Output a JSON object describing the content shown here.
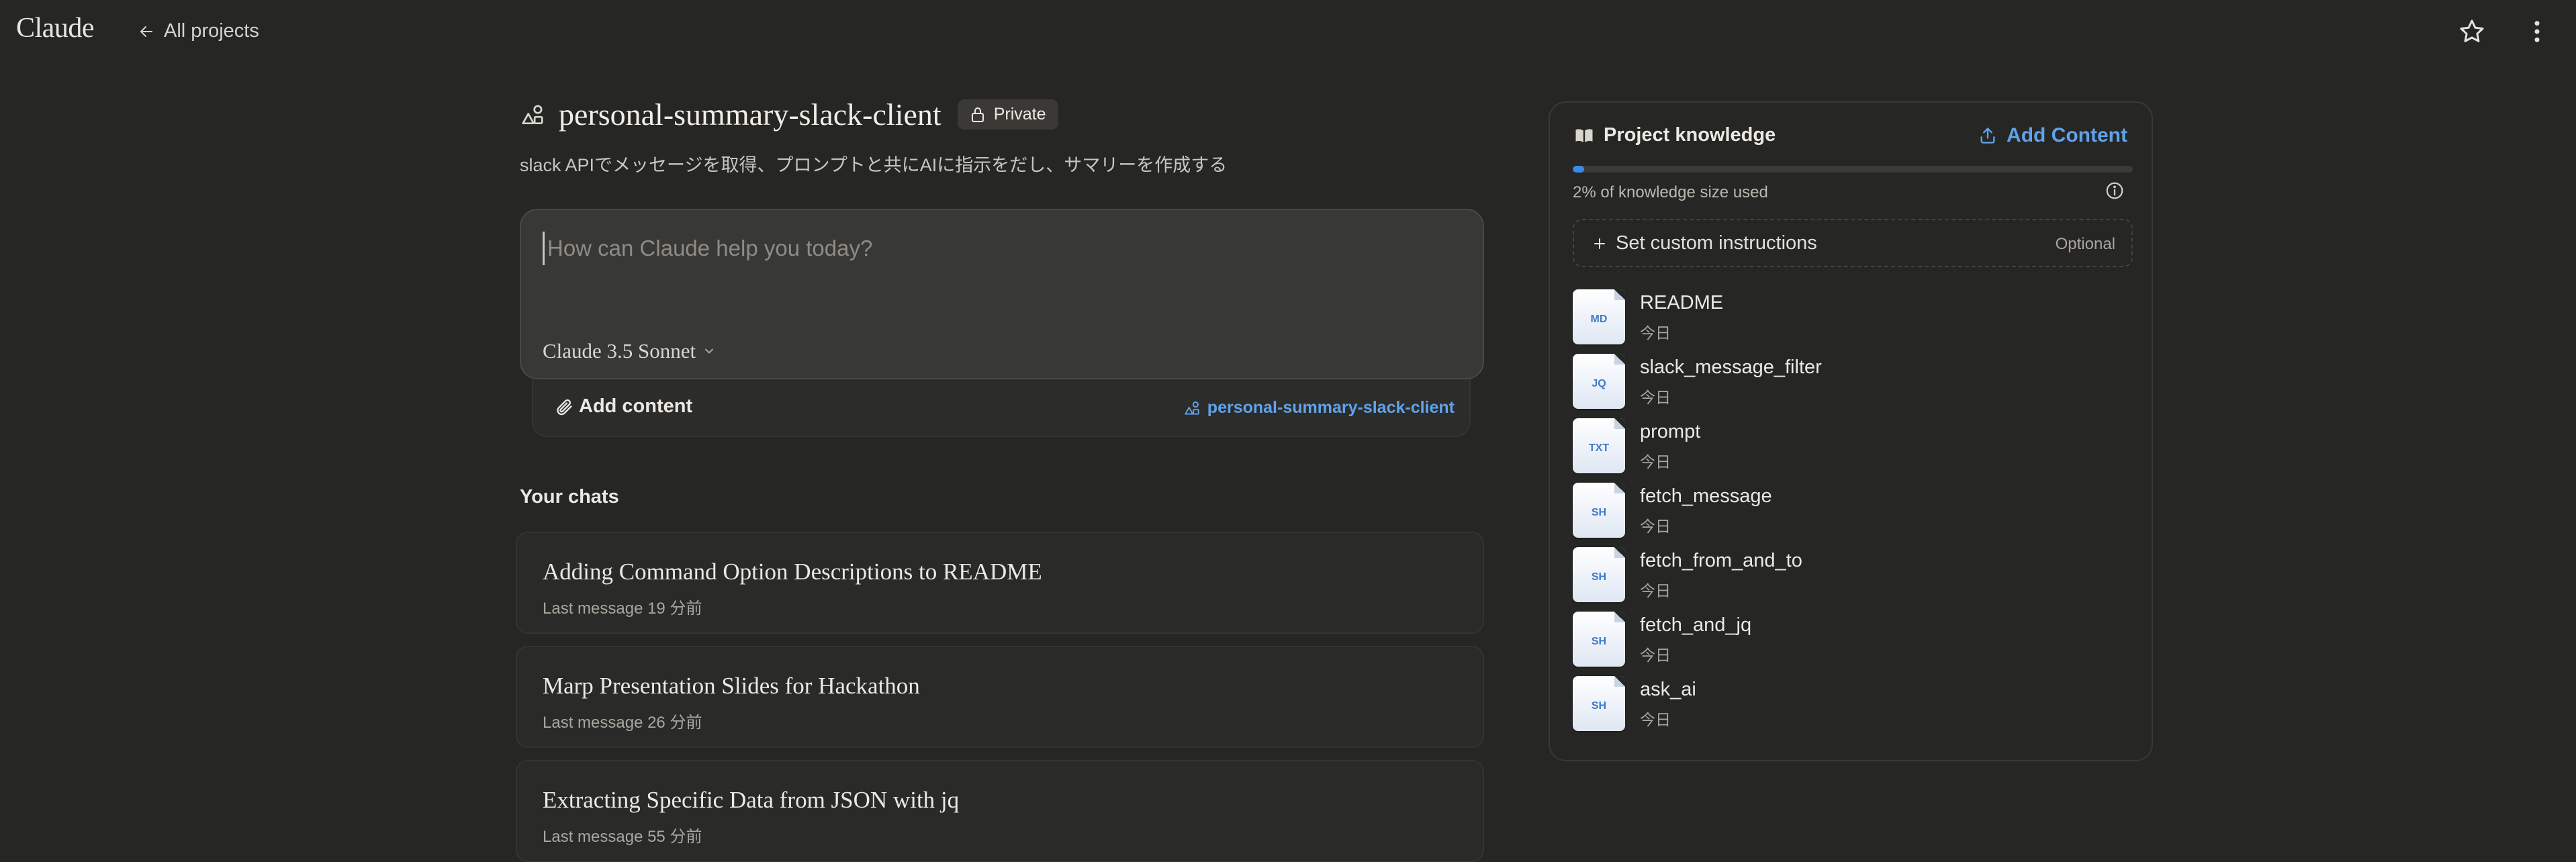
{
  "app": {
    "logo": "Claude"
  },
  "nav": {
    "back_label": "All projects"
  },
  "project": {
    "title": "personal-summary-slack-client",
    "visibility": "Private",
    "description": "slack APIでメッセージを取得、プロンプトと共にAIに指示をだし、サマリーを作成する"
  },
  "composer": {
    "placeholder": "How can Claude help you today?",
    "model": "Claude 3.5 Sonnet",
    "add_content_label": "Add content",
    "project_link": "personal-summary-slack-client"
  },
  "chats": {
    "heading": "Your chats",
    "items": [
      {
        "title": "Adding Command Option Descriptions to README",
        "subtitle": "Last message 19 分前"
      },
      {
        "title": "Marp Presentation Slides for Hackathon",
        "subtitle": "Last message 26 分前"
      },
      {
        "title": "Extracting Specific Data from JSON with jq",
        "subtitle": "Last message 55 分前"
      }
    ]
  },
  "knowledge": {
    "heading": "Project knowledge",
    "add_label": "Add Content",
    "usage_fraction": 0.02,
    "usage_text": "2% of knowledge size used",
    "instructions_label": "Set custom instructions",
    "instructions_optional": "Optional",
    "files": [
      {
        "type": "MD",
        "name": "README",
        "date": "今日"
      },
      {
        "type": "JQ",
        "name": "slack_message_filter",
        "date": "今日"
      },
      {
        "type": "TXT",
        "name": "prompt",
        "date": "今日"
      },
      {
        "type": "SH",
        "name": "fetch_message",
        "date": "今日"
      },
      {
        "type": "SH",
        "name": "fetch_from_and_to",
        "date": "今日"
      },
      {
        "type": "SH",
        "name": "fetch_and_jq",
        "date": "今日"
      },
      {
        "type": "SH",
        "name": "ask_ai",
        "date": "今日"
      }
    ]
  },
  "colors": {
    "background": "#262624",
    "accent": "#5fa3ec",
    "progress": "#3d8ae6"
  },
  "icons": [
    "arrow-left-icon",
    "star-icon",
    "more-vertical-icon",
    "project-icon",
    "lock-icon",
    "chevron-down-icon",
    "paperclip-icon",
    "book-icon",
    "upload-icon",
    "info-icon",
    "plus-icon",
    "file-icon"
  ]
}
